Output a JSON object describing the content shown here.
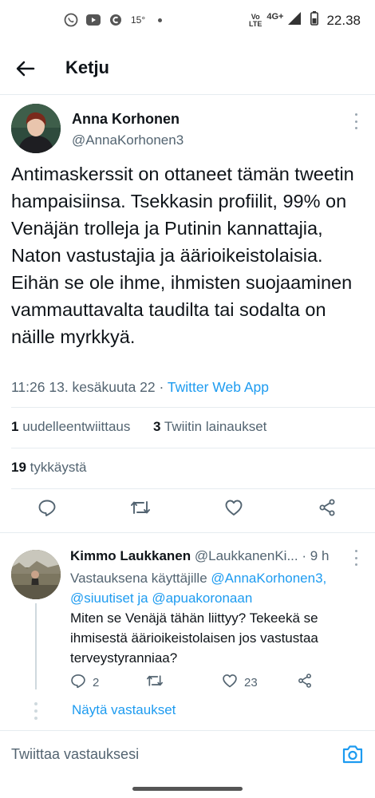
{
  "status_bar": {
    "temperature": "15°",
    "network_label_top": "Vo",
    "network_label_bottom": "LTE",
    "network_type": "4G+",
    "time": "22.38"
  },
  "header": {
    "title": "Ketju"
  },
  "tweet": {
    "author_name": "Anna Korhonen",
    "author_handle": "@AnnaKorhonen3",
    "text": "Antimaskerssit on ottaneet tämän tweetin hampaisiinsa. Tsekkasin profiilit, 99% on Venäjän trolleja ja Putinin kannattajia, Naton vastustajia ja äärioikeistolaisia. Eihän se ole ihme, ihmisten suojaaminen vammauttavalta taudilta tai sodalta on näille myrkkyä.",
    "timestamp": "11:26 13. kesäkuuta 22",
    "separator": "·",
    "source_app": "Twitter Web App",
    "retweets_count": "1",
    "retweets_label": "uudelleentwiittaus",
    "quotes_count": "3",
    "quotes_label": "Twiitin lainaukset",
    "likes_count": "19",
    "likes_label": "tykkäystä"
  },
  "reply": {
    "author_name": "Kimmo Laukkanen",
    "author_handle": "@LaukkanenKi...",
    "separator": "·",
    "time_ago": "9 h",
    "reply_to_prefix": "Vastauksena käyttäjille",
    "mention_1": "@AnnaKorhonen3,",
    "mention_2": "@siuutiset",
    "conjunction": "ja",
    "mention_3": "@apuakoronaan",
    "text": "Miten se Venäjä tähän liittyy? Tekeekä se ihmisestä äärioikeistolaisen jos vastustaa terveystyranniaa?",
    "reply_count": "2",
    "like_count": "23",
    "show_replies": "Näytä vastaukset"
  },
  "composer": {
    "placeholder": "Twiittaa vastauksesi"
  },
  "colors": {
    "accent": "#1d9bf0",
    "secondary_text": "#536471",
    "primary_text": "#0f1419"
  },
  "icons": {
    "status": [
      "whatsapp-icon",
      "youtube-icon",
      "c-app-icon",
      "signal-icon",
      "battery-icon"
    ],
    "header": "back-arrow-icon",
    "actions": [
      "reply-icon",
      "retweet-icon",
      "like-icon",
      "share-icon"
    ],
    "composer": "camera-icon"
  }
}
